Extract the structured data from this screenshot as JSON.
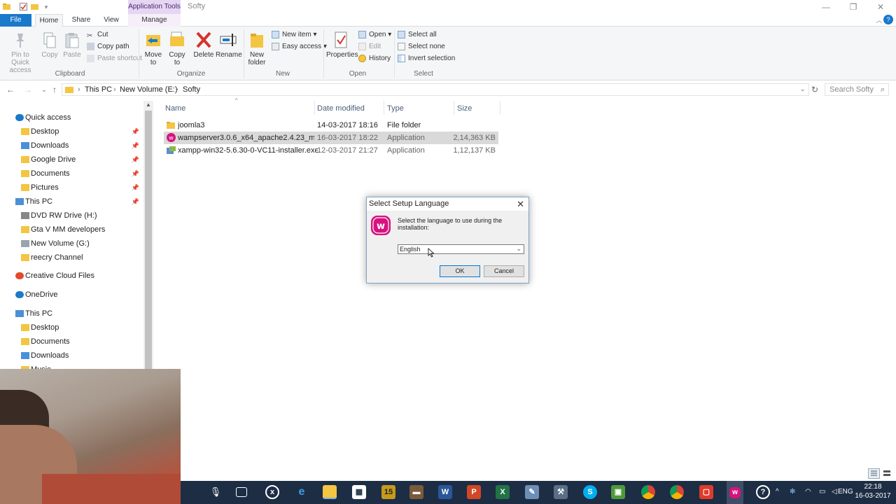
{
  "window": {
    "title": "Softy",
    "context_tab": "Application Tools"
  },
  "tabs": {
    "file": "File",
    "home": "Home",
    "share": "Share",
    "view": "View",
    "manage": "Manage"
  },
  "ribbon": {
    "clipboard": {
      "pin": "Pin to Quick access",
      "copy": "Copy",
      "paste": "Paste",
      "cut": "Cut",
      "copy_path": "Copy path",
      "paste_shortcut": "Paste shortcut",
      "group": "Clipboard"
    },
    "organize": {
      "move_to": "Move to",
      "copy_to": "Copy to",
      "delete": "Delete",
      "rename": "Rename",
      "group": "Organize"
    },
    "new": {
      "new_folder": "New folder",
      "new_item": "New item",
      "easy_access": "Easy access",
      "group": "New"
    },
    "open": {
      "properties": "Properties",
      "open": "Open",
      "edit": "Edit",
      "history": "History",
      "group": "Open"
    },
    "select": {
      "select_all": "Select all",
      "select_none": "Select none",
      "invert_selection": "Invert selection",
      "group": "Select"
    }
  },
  "address": {
    "crumbs": [
      "This PC",
      "New Volume (E:)",
      "Softy"
    ],
    "search_placeholder": "Search Softy"
  },
  "nav_pane": {
    "items": [
      {
        "label": "Quick access",
        "icon": "star-icon",
        "pinned": false
      },
      {
        "label": "Desktop",
        "icon": "folder-icon",
        "pinned": true
      },
      {
        "label": "Downloads",
        "icon": "download-folder-icon",
        "pinned": true
      },
      {
        "label": "Google Drive",
        "icon": "google-drive-icon",
        "pinned": true
      },
      {
        "label": "Documents",
        "icon": "documents-folder-icon",
        "pinned": true
      },
      {
        "label": "Pictures",
        "icon": "pictures-folder-icon",
        "pinned": true
      },
      {
        "label": "This PC",
        "icon": "computer-icon",
        "pinned": true
      },
      {
        "label": "DVD RW Drive (H:)",
        "icon": "dvd-drive-icon",
        "pinned": false
      },
      {
        "label": "Gta V MM developers",
        "icon": "folder-icon",
        "pinned": false
      },
      {
        "label": "New Volume (G:)",
        "icon": "drive-icon",
        "pinned": false
      },
      {
        "label": "reecry Channel",
        "icon": "folder-icon",
        "pinned": false
      },
      {
        "label": "Creative Cloud Files",
        "icon": "creative-cloud-icon",
        "pinned": false
      },
      {
        "label": "OneDrive",
        "icon": "onedrive-icon",
        "pinned": false
      },
      {
        "label": "This PC",
        "icon": "computer-icon",
        "pinned": false
      },
      {
        "label": "Desktop",
        "icon": "folder-icon",
        "pinned": false
      },
      {
        "label": "Documents",
        "icon": "documents-folder-icon",
        "pinned": false
      },
      {
        "label": "Downloads",
        "icon": "download-folder-icon",
        "pinned": false
      },
      {
        "label": "Music",
        "icon": "music-folder-icon",
        "pinned": false
      }
    ]
  },
  "file_list": {
    "columns": [
      "Name",
      "Date modified",
      "Type",
      "Size"
    ],
    "rows": [
      {
        "name": "joomla3",
        "date": "14-03-2017 18:16",
        "type": "File folder",
        "size": "",
        "icon": "folder-icon",
        "selected": false
      },
      {
        "name": "wampserver3.0.6_x64_apache2.4.23_mysq...",
        "date": "16-03-2017 18:22",
        "type": "Application",
        "size": "2,14,363 KB",
        "icon": "wampserver-icon",
        "selected": true
      },
      {
        "name": "xampp-win32-5.6.30-0-VC11-installer.exe",
        "date": "12-03-2017 21:27",
        "type": "Application",
        "size": "1,12,137 KB",
        "icon": "xampp-installer-icon",
        "selected": false
      }
    ]
  },
  "dialog": {
    "title": "Select Setup Language",
    "message": "Select the language to use during the installation:",
    "selected_language": "English",
    "ok": "OK",
    "cancel": "Cancel"
  },
  "taskbar": {
    "lang": "ENG",
    "time": "22:18",
    "date": "16-03-2017"
  },
  "colors": {
    "file_tab": "#1979ca",
    "context_tab": "#e6d6f2",
    "selection": "#d9d9d9",
    "taskbar": "#1d2d44",
    "wamp_brand": "#d6137f"
  }
}
